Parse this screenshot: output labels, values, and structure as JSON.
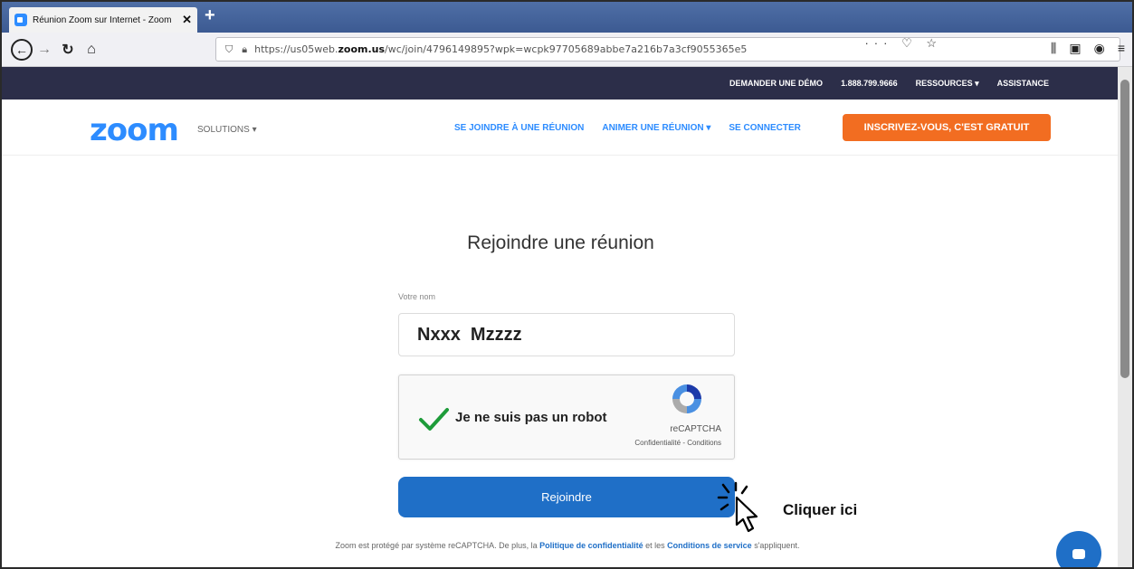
{
  "browser": {
    "tab_title": "Réunion Zoom sur Internet - Zoom",
    "tab_close": "✕",
    "new_tab": "+",
    "url_prefix": "https://us05web.",
    "url_domain": "zoom.us",
    "url_path": "/wc/join/4796149895?wpk=wcpk97705689abbe7a216b7a3cf9055365e5",
    "url_more": "···"
  },
  "topbar": {
    "demo": "DEMANDER UNE DÉMO",
    "phone": "1.888.799.9666",
    "resources": "RESSOURCES ▾",
    "support": "ASSISTANCE"
  },
  "header": {
    "logo": "zoom",
    "solutions": "SOLUTIONS ▾",
    "join_link": "SE JOINDRE À UNE RÉUNION",
    "host_link": "ANIMER UNE RÉUNION ▾",
    "signin_link": "SE CONNECTER",
    "signup": "INSCRIVEZ-VOUS, C'EST GRATUIT"
  },
  "join": {
    "title": "Rejoindre une réunion",
    "name_label": "Votre nom",
    "name_value": "Nxxx  Mzzzz",
    "button": "Rejoindre"
  },
  "captcha": {
    "label": "Je ne suis pas un robot",
    "brand": "reCAPTCHA",
    "links": "Confidentialité - Conditions",
    "checked": true
  },
  "annotation": {
    "text": "Cliquer ici"
  },
  "footer": {
    "pre": "Zoom est protégé par système reCAPTCHA. De plus, la ",
    "privacy": "Politique de confidentialité",
    "mid": " et les ",
    "terms": "Conditions de service",
    "post": " s'appliquent."
  },
  "colors": {
    "brand_blue": "#2d8cff",
    "topbar_bg": "#2c2e49",
    "signup_orange": "#f26d21",
    "join_button": "#1f6fc7"
  }
}
